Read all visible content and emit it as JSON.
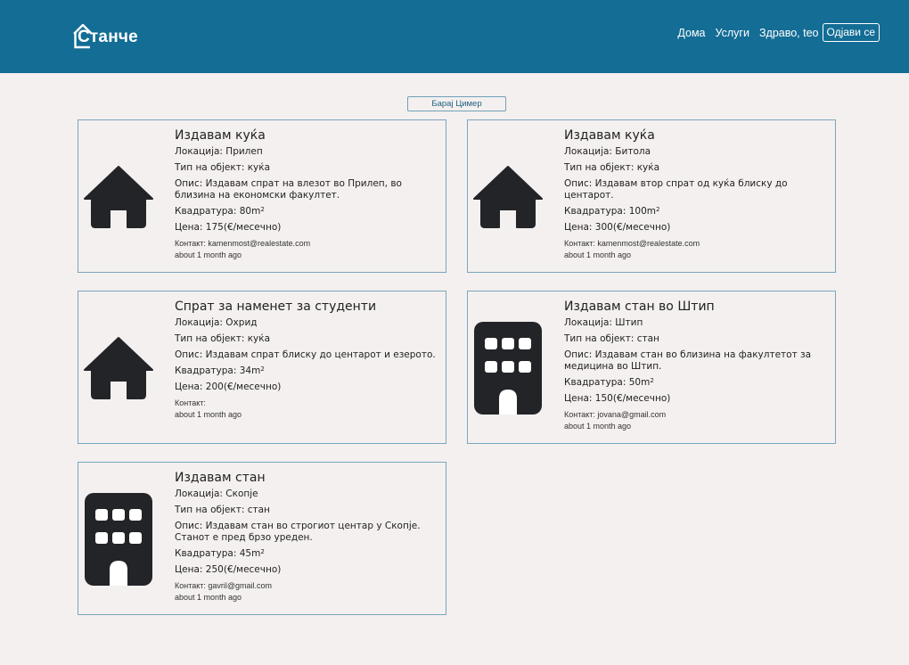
{
  "nav": {
    "brand": "Станче",
    "home": "Дома",
    "services": "Услуги",
    "greeting": "Здраво, teo",
    "logout": "Одјави се"
  },
  "search": {
    "label": "Барај Цимер"
  },
  "labels": {
    "location": "Локација: ",
    "type": "Тип на објект: ",
    "description": "Опис: ",
    "area": "Квадратура: ",
    "area_unit": "m",
    "area_sup": "2",
    "price": "Цена: ",
    "price_unit": "(€/месечно)",
    "contact": "Контакт: "
  },
  "listings": [
    {
      "title": "Издавам куќа",
      "location": "Прилеп",
      "type": "куќа",
      "description": "Издавам спрат на влезот во Прилеп, во близина на економски факултет.",
      "area": "80",
      "price": "175",
      "contact": "kamenmost@realestate.com",
      "posted": "about 1 month ago",
      "icon": "house-icon"
    },
    {
      "title": "Издавам куќа",
      "location": "Битола",
      "type": "куќа",
      "description": "Издавам втор спрат од куќа блиску до центарот.",
      "area": "100",
      "price": "300",
      "contact": "kamenmost@realestate.com",
      "posted": "about 1 month ago",
      "icon": "house-icon"
    },
    {
      "title": "Спрат за наменет за студенти",
      "location": "Охрид",
      "type": "куќа",
      "description": "Издавам спрат блиску до центарот и езерото.",
      "area": "34",
      "price": "200",
      "contact": "",
      "posted": "about 1 month ago",
      "icon": "house-icon"
    },
    {
      "title": "Издавам стан во Штип",
      "location": "Штип",
      "type": "стан",
      "description": "Издавам стан во близина на факултетот за медицина во Штип.",
      "area": "50",
      "price": "150",
      "contact": "jovana@gmail.com",
      "posted": "about 1 month ago",
      "icon": "building-icon"
    },
    {
      "title": "Издавам стан",
      "location": "Скопје",
      "type": "стан",
      "description": "Издавам стан во строгиот центар у Скопје. Станот е пред брзо уреден.",
      "area": "45",
      "price": "250",
      "contact": "gavril@gmail.com",
      "posted": "about 1 month ago",
      "icon": "building-icon"
    }
  ],
  "colors": {
    "navbar": "#136d95",
    "background": "#f4f0ef",
    "card_border": "#7aa6bd",
    "icon": "#222428"
  }
}
